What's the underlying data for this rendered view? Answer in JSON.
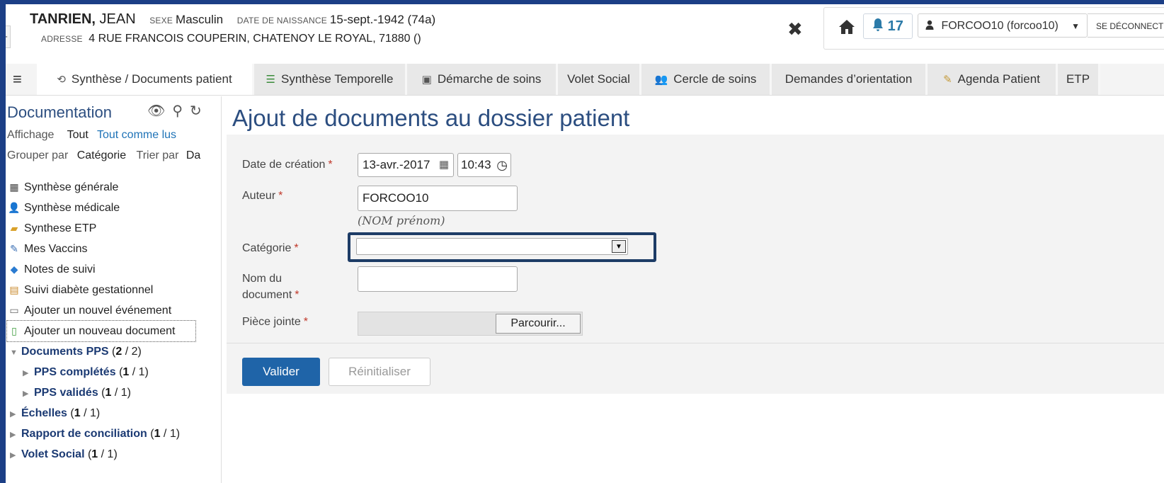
{
  "header": {
    "last_name": "TANRIEN,",
    "first_name": "JEAN",
    "sex_label": "SEXE",
    "sex_value": "Masculin",
    "dob_label": "DATE DE NAISSANCE",
    "dob_value": "15-sept.-1942 (74a)",
    "address_label": "ADRESSE",
    "address_value": "4 RUE FRANCOIS COUPERIN, CHATENOY LE ROYAL, 71880 ()",
    "close_icon": "close-icon",
    "home_icon": "home-icon",
    "notification_icon": "bell-icon",
    "notification_count": "17",
    "user_icon": "user-icon",
    "user_label": "FORCOO10 (forcoo10)",
    "logout_label": "SE DÉCONNECTER"
  },
  "tabs": [
    {
      "label": "Synthèse / Documents patient",
      "icon": "history-icon",
      "active": true
    },
    {
      "label": "Synthèse Temporelle",
      "icon": "timeline-icon"
    },
    {
      "label": "Démarche de soins",
      "icon": "medkit-icon"
    },
    {
      "label": "Volet Social",
      "icon": ""
    },
    {
      "label": "Cercle de soins",
      "icon": "users-icon"
    },
    {
      "label": "Demandes d’orientation",
      "icon": ""
    },
    {
      "label": "Agenda Patient",
      "icon": "agenda-icon"
    },
    {
      "label": "ETP",
      "icon": ""
    }
  ],
  "sidebar": {
    "title": "Documentation",
    "display_label": "Affichage",
    "display_all": "Tout",
    "display_all_read": "Tout comme lus",
    "group_label": "Grouper par",
    "group_value": "Catégorie",
    "sort_label": "Trier par",
    "sort_value": "Da",
    "items": [
      {
        "label": "Synthèse générale",
        "icon": "grid-icon"
      },
      {
        "label": "Synthèse médicale",
        "icon": "doctor-icon"
      },
      {
        "label": "Synthese ETP",
        "icon": "book-icon"
      },
      {
        "label": "Mes Vaccins",
        "icon": "syringe-icon"
      },
      {
        "label": "Notes de suivi",
        "icon": "notes-icon"
      },
      {
        "label": "Suivi diabète gestationnel",
        "icon": "clipboard-icon"
      },
      {
        "label": "Ajouter un nouvel événement",
        "icon": "calendar-icon"
      },
      {
        "label": "Ajouter un nouveau document",
        "icon": "new-document-icon"
      }
    ],
    "tree": [
      {
        "name": "Documents PPS",
        "count_a": "2",
        "count_b": "2"
      },
      {
        "name": "PPS complétés",
        "count_a": "1",
        "count_b": "1"
      },
      {
        "name": "PPS validés",
        "count_a": "1",
        "count_b": "1"
      },
      {
        "name": "Échelles",
        "count_a": "1",
        "count_b": "1"
      },
      {
        "name": "Rapport de conciliation",
        "count_a": "1",
        "count_b": "1"
      },
      {
        "name": "Volet Social",
        "count_a": "1",
        "count_b": "1"
      }
    ]
  },
  "main": {
    "title": "Ajout de documents au dossier patient",
    "date_label": "Date de création",
    "date_value": "13-avr.-2017",
    "time_value": "10:43",
    "author_label": "Auteur",
    "author_value": "FORCOO10",
    "author_hint": "(NOM prénom)",
    "category_label": "Catégorie",
    "category_value": "",
    "docname_label_1": "Nom du",
    "docname_label_2": "document",
    "docname_value": "",
    "attachment_label": "Pièce jointe",
    "browse_label": "Parcourir...",
    "required_mark": "*",
    "submit_label": "Valider",
    "reset_label": "Réinitialiser"
  }
}
